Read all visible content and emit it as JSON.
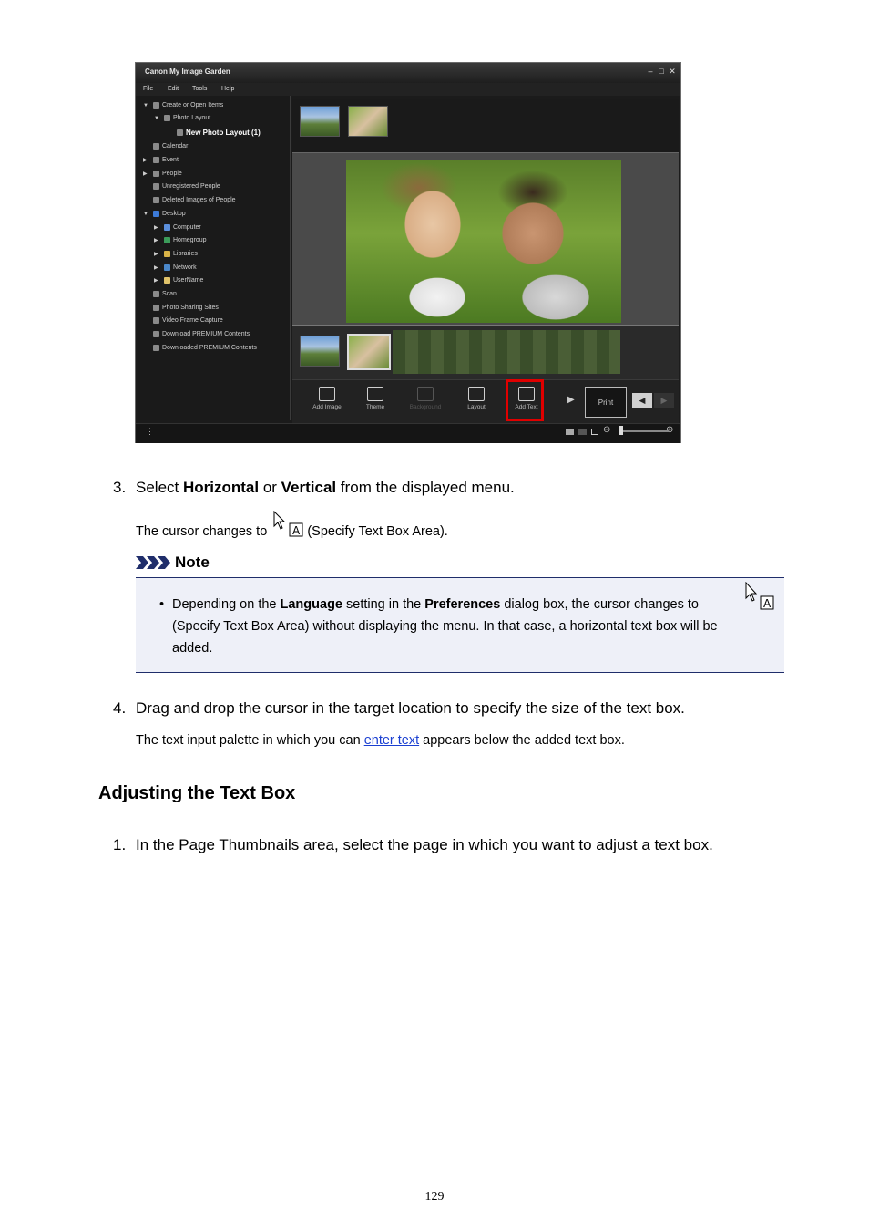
{
  "app": {
    "title": "Canon My Image Garden",
    "menu": [
      "File",
      "Edit",
      "Tools",
      "Help"
    ],
    "tree": [
      {
        "label": "Create or Open Items",
        "arrow": "▼"
      },
      {
        "label": "Photo Layout",
        "arrow": "▼"
      },
      {
        "label": "New Photo Layout (1)",
        "arrow": ""
      },
      {
        "label": "Calendar",
        "arrow": ""
      },
      {
        "label": "Event",
        "arrow": "▶"
      },
      {
        "label": "People",
        "arrow": "▶"
      },
      {
        "label": "Unregistered People",
        "arrow": ""
      },
      {
        "label": "Deleted Images of People",
        "arrow": ""
      },
      {
        "label": "Desktop",
        "arrow": "▼"
      },
      {
        "label": "Computer",
        "arrow": "▶"
      },
      {
        "label": "Homegroup",
        "arrow": "▶"
      },
      {
        "label": "Libraries",
        "arrow": "▶"
      },
      {
        "label": "Network",
        "arrow": "▶"
      },
      {
        "label": "UserName",
        "arrow": "▶"
      },
      {
        "label": "Scan",
        "arrow": ""
      },
      {
        "label": "Photo Sharing Sites",
        "arrow": ""
      },
      {
        "label": "Video Frame Capture",
        "arrow": ""
      },
      {
        "label": "Download PREMIUM Contents",
        "arrow": ""
      },
      {
        "label": "Downloaded PREMIUM Contents",
        "arrow": ""
      }
    ],
    "toolbar": {
      "add_image": "Add Image",
      "theme": "Theme",
      "background": "Background",
      "layout": "Layout",
      "add_text": "Add Text",
      "print": "Print"
    },
    "colors": {
      "highlight": "#e00000"
    }
  },
  "step3": {
    "number": "3.",
    "pre": "Select ",
    "bold1": "Horizontal",
    "mid": " or ",
    "bold2": "Vertical",
    "post": " from the displayed menu.",
    "sub_pre": "The cursor changes to ",
    "sub_post": " (Specify Text Box Area)."
  },
  "note": {
    "heading": "Note",
    "bullet": "•",
    "t1": "Depending on the ",
    "b1": "Language",
    "t2": " setting in the ",
    "b2": "Preferences",
    "t3": " dialog box, the cursor changes to",
    "line2": "(Specify Text Box Area) without displaying the menu. In that case, a horizontal text box will be",
    "line3": "added."
  },
  "step4": {
    "number": "4.",
    "text": "Drag and drop the cursor in the target location to specify the size of the text box.",
    "sub_pre": "The text input palette in which you can ",
    "sub_link": "enter text",
    "sub_post": " appears below the added text box."
  },
  "section": {
    "heading": "Adjusting the Text Box"
  },
  "step1": {
    "number": "1.",
    "text": "In the Page Thumbnails area, select the page in which you want to adjust a text box."
  },
  "page_number": "129"
}
